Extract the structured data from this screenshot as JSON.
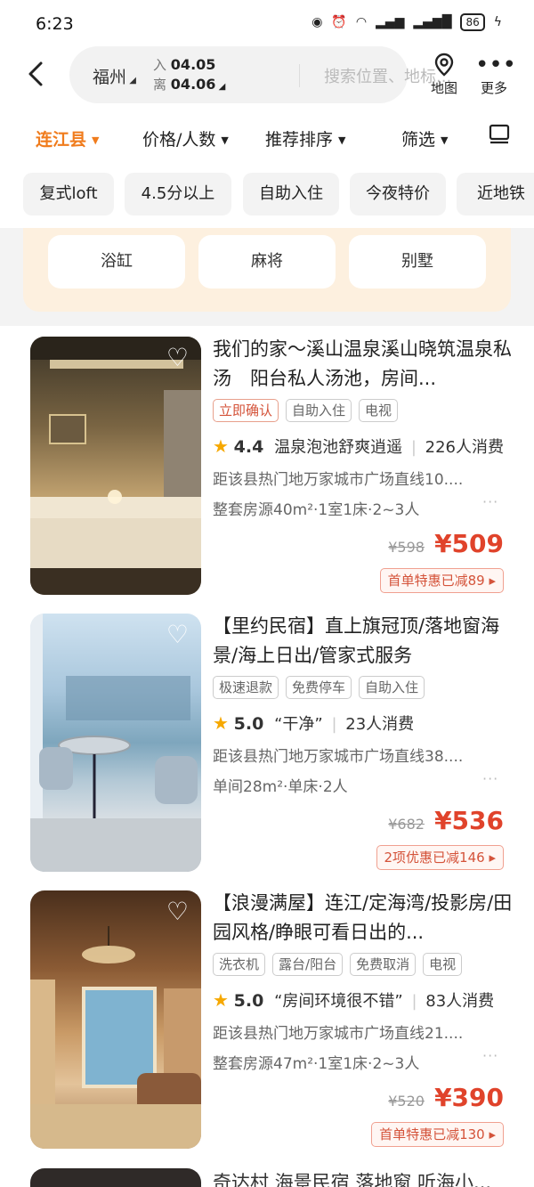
{
  "status": {
    "time": "6:23",
    "battery": "86"
  },
  "header": {
    "city": "福州",
    "checkin_label": "入",
    "checkin_date": "04.05",
    "checkout_label": "离",
    "checkout_date": "04.06",
    "search_placeholder": "搜索位置、地标...",
    "map_label": "地图",
    "more_label": "更多"
  },
  "filters": [
    "连江县",
    "价格/人数",
    "推荐排序",
    "筛选"
  ],
  "quick_tags": [
    "复式loft",
    "4.5分以上",
    "自助入住",
    "今夜特价",
    "近地铁"
  ],
  "promo_options": [
    "浴缸",
    "麻将",
    "别墅"
  ],
  "listings": [
    {
      "title": "我们的家～溪山温泉溪山晓筑温泉私汤　阳台私人汤池，房间...",
      "badges": [
        "立即确认",
        "自助入住",
        "电视"
      ],
      "score": "4.4",
      "review": "温泉泡池舒爽逍遥",
      "consumers": "226人消费",
      "distance": "距该县热门地万家城市广场直线10....",
      "room": "整套房源40m²·1室1床·2~3人",
      "original_price": "¥598",
      "price": "¥509",
      "promo": "首单特惠已减89 ▸"
    },
    {
      "title": "【里约民宿】直上旗冠顶/落地窗海景/海上日出/管家式服务",
      "badges": [
        "极速退款",
        "免费停车",
        "自助入住"
      ],
      "score": "5.0",
      "review": "“干净”",
      "consumers": "23人消费",
      "distance": "距该县热门地万家城市广场直线38....",
      "room": "单间28m²·单床·2人",
      "original_price": "¥682",
      "price": "¥536",
      "promo": "2项优惠已减146 ▸"
    },
    {
      "title": "【浪漫满屋】连江/定海湾/投影房/田园风格/睁眼可看日出的...",
      "badges": [
        "洗衣机",
        "露台/阳台",
        "免费取消",
        "电视"
      ],
      "score": "5.0",
      "review": "“房间环境很不错”",
      "consumers": "83人消费",
      "distance": "距该县热门地万家城市广场直线21....",
      "room": "整套房源47m²·1室1床·2~3人",
      "original_price": "¥520",
      "price": "¥390",
      "promo": "首单特惠已减130 ▸"
    },
    {
      "title": "奇达村 海景民宿 落地窗 听海小..."
    }
  ],
  "colors": {
    "accent": "#f07c1d",
    "price": "#e0432b",
    "star": "#f6a800"
  }
}
